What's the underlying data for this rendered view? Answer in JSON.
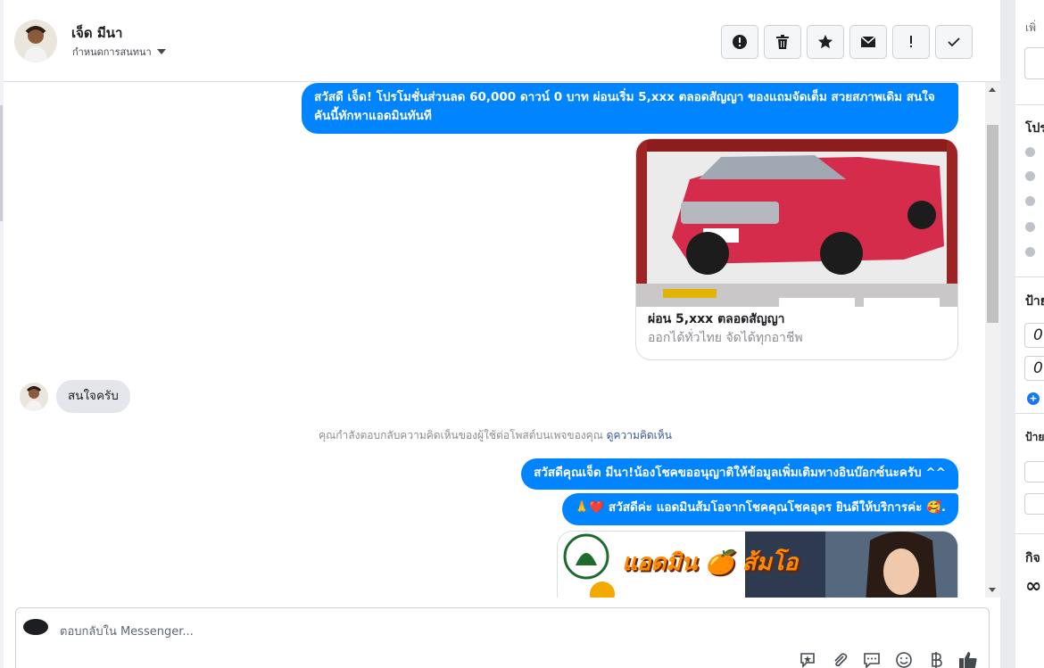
{
  "contact": {
    "name": "เจ็ด มีนา",
    "assign_label": "กำหนดการสนทนา"
  },
  "header_actions": [
    {
      "icon": "alert-circle-icon",
      "glyph": "!"
    },
    {
      "icon": "trash-icon",
      "glyph": "🗑"
    },
    {
      "icon": "star-icon",
      "glyph": "★"
    },
    {
      "icon": "envelope-icon",
      "glyph": "✉"
    },
    {
      "icon": "exclamation-icon",
      "glyph": "!"
    },
    {
      "icon": "check-icon",
      "glyph": "✓"
    }
  ],
  "messages": {
    "out1": "สวัสดี เจ็ด! โปรโมชั่นส่วนลด 60,000 ดาวน์ 0 บาท ผ่อนเริ่ม 5,xxx ตลอดสัญญา ของแถมจัดเต็ม สวยสภาพเดิม สนใจคันนี้ทักหาแอดมินทันที",
    "card_title": "ผ่อน 5,xxx ตลอดสัญญา",
    "card_subtitle": "ออกได้ทั่วไทย จัดได้ทุกอาชีพ",
    "in1": "สนใจครับ",
    "notice_text": "คุณกำลังตอบกลับความคิดเห็นของผู้ใช้ต่อโพสต์บนเพจของคุณ",
    "notice_link": "ดูความคิดเห็น",
    "out2": "สวัสดีคุณเจ็ด มีนา!น้องโชคขออนุญาติให้ข้อมูลเพิ่มเติมทางอินบ๊อกซ์นะครับ ^^",
    "out3": "🙏❤️ สวัสดีค่ะ แอดมินส้มโอจากโชคคุณโชคอุดร ยินดีให้บริการค่ะ 🥰.",
    "promo_text": "แอดมิน 🍊 ส้มโอ"
  },
  "composer": {
    "placeholder": "ตอบกลับใน Messenger...",
    "tools": [
      {
        "icon": "saved-reply-icon",
        "glyph": "✦"
      },
      {
        "icon": "attachment-icon",
        "glyph": "📎"
      },
      {
        "icon": "chat-bubble-icon",
        "glyph": "💬"
      },
      {
        "icon": "emoji-icon",
        "glyph": "☺"
      },
      {
        "icon": "baht-icon",
        "glyph": "฿"
      },
      {
        "icon": "thumbs-up-icon",
        "glyph": "👍"
      }
    ]
  },
  "right_panel": {
    "top_heading": "เพิ่",
    "heading_profile": "โปร",
    "heading_labels": "ป้าย",
    "sub_labels": "ป้าย",
    "heading_activity": "กิจ",
    "num_values": [
      "0",
      "0"
    ],
    "infinity": "∞"
  },
  "colors": {
    "accent": "#0084ff",
    "incoming_bg": "#e4e6eb"
  }
}
